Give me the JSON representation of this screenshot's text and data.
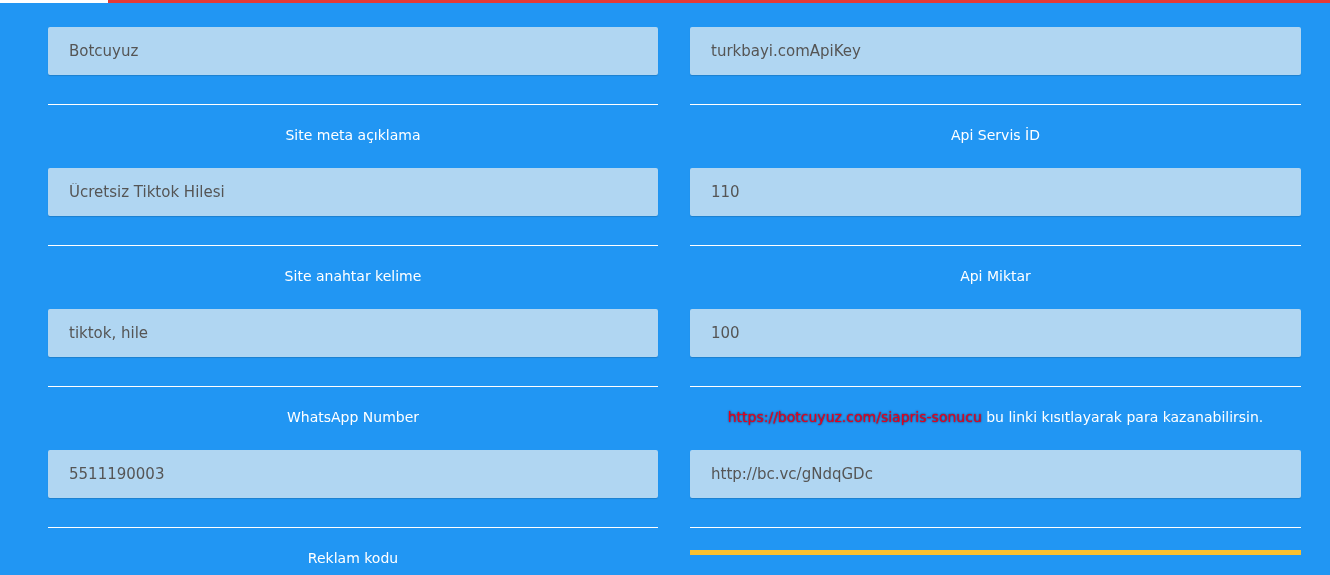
{
  "rows": [
    {
      "cells": [
        {
          "kind": "field",
          "value": "Botcuyuz"
        },
        {
          "kind": "field",
          "value": "turkbayi.comApiKey"
        }
      ]
    },
    {
      "cells": [
        {
          "kind": "field",
          "label": {
            "text": "Site meta açıklama"
          },
          "value": "Ücretsiz Tiktok Hilesi"
        },
        {
          "kind": "field",
          "label": {
            "text": "Api Servis İD"
          },
          "value": "110"
        }
      ]
    },
    {
      "cells": [
        {
          "kind": "field",
          "label": {
            "text": "Site anahtar kelime"
          },
          "value": "tiktok, hile"
        },
        {
          "kind": "field",
          "label": {
            "text": "Api Miktar"
          },
          "value": "100"
        }
      ]
    },
    {
      "cells": [
        {
          "kind": "field",
          "label": {
            "text": "WhatsApp Number"
          },
          "value": "5511190003"
        },
        {
          "kind": "field",
          "label": {
            "link": "https://botcuyuz.com/siapris-sonucu",
            "text": "bu linki kısıtlayarak para kazanabilirsin."
          },
          "value": "http://bc.vc/gNdqGDc"
        }
      ]
    },
    {
      "cells": [
        {
          "kind": "label",
          "label": {
            "text": "Reklam kodu"
          }
        },
        {
          "kind": "bar"
        }
      ]
    }
  ]
}
